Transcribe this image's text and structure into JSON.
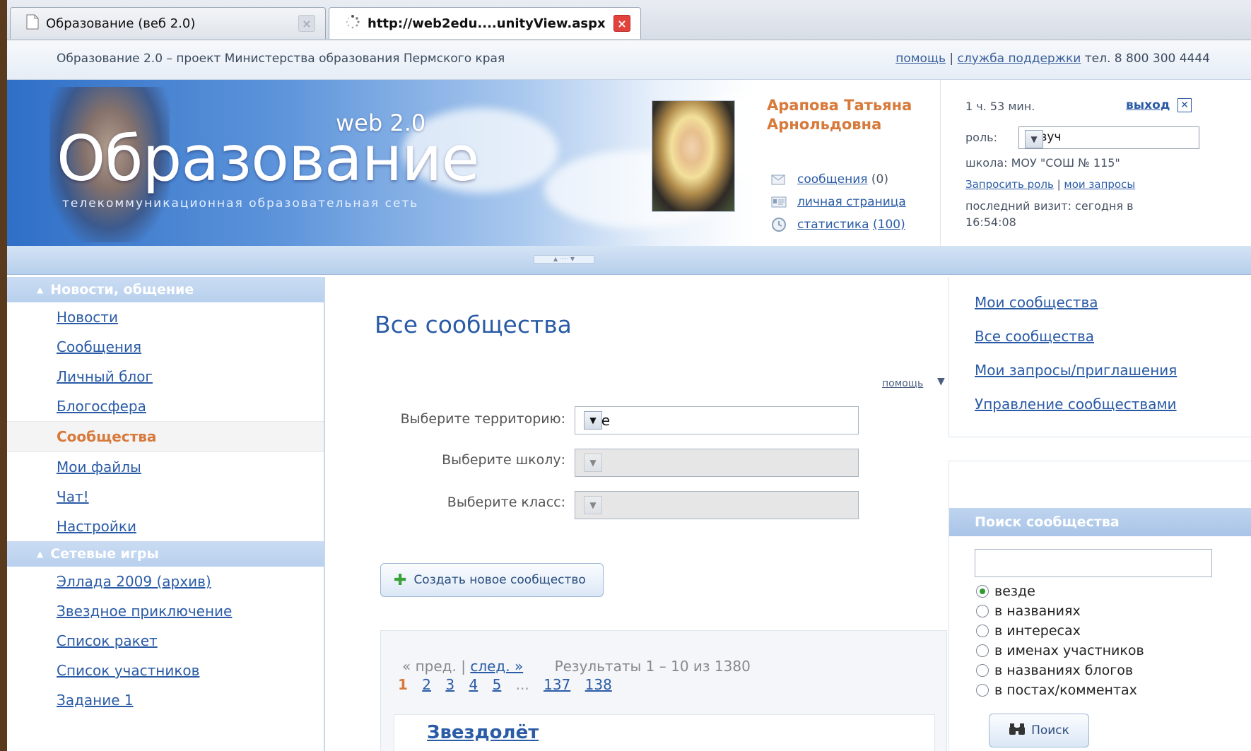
{
  "tabs": [
    {
      "label": "Образование (веб 2.0)",
      "close": "×"
    },
    {
      "label": "http://web2edu....unityView.aspx",
      "close": "×"
    }
  ],
  "topbar": {
    "project": "Образование 2.0 – проект Министерства образования Пермского края",
    "help": "помощь",
    "separator": "|",
    "support": "служба поддержки",
    "phone": "тел. 8 800 300 4444"
  },
  "banner": {
    "web": "web 2.0",
    "logo": "Образование",
    "subtitle": "телекоммуникационная образовательная сеть"
  },
  "user": {
    "name": "Арапова Татьяна Арнольдовна",
    "links": [
      {
        "label": "сообщения",
        "count": "(0)",
        "icon": "envelope-icon"
      },
      {
        "label": "личная страница",
        "count": "",
        "icon": "id-card-icon"
      },
      {
        "label": "статистика",
        "count": "(100)",
        "icon": "clock-icon"
      }
    ],
    "time": "1 ч. 53 мин.",
    "logout": "выход",
    "role_label": "роль:",
    "role_value": "Завуч",
    "school": "школа: МОУ \"СОШ № 115\"",
    "request_role": "Запросить роль",
    "my_requests": "мои запросы",
    "last_visit": "последний визит: сегодня в 16:54:08"
  },
  "leftnav": {
    "section1": "Новости, общение",
    "items1": [
      "Новости",
      "Сообщения",
      "Личный блог",
      "Блогосфера"
    ],
    "active": "Сообщества",
    "items1b": [
      "Мои файлы",
      "Чат!",
      "Настройки"
    ],
    "section2": "Сетевые игры",
    "items2": [
      "Эллада 2009 (архив)",
      "Звездное приключение",
      "Список ракет",
      "Список участников",
      "Задание 1"
    ]
  },
  "main": {
    "title": "Все сообщества",
    "help": "помощь",
    "territory_label": "Выберите территорию:",
    "territory_value": "Все",
    "school_label": "Выберите школу:",
    "class_label": "Выберите класс:",
    "create_button": "Создать новое сообщество",
    "prev": "« пред.",
    "pipe": "|",
    "next": "след. »",
    "results": "Результаты 1 – 10 из 1380",
    "pages": [
      "1",
      "2",
      "3",
      "4",
      "5"
    ],
    "ellipsis": "...",
    "last_pages": [
      "137",
      "138"
    ],
    "first_result": "Звездолёт"
  },
  "right": {
    "links": [
      "Мои сообщества",
      "Все сообщества",
      "Мои запросы/приглашения",
      "Управление сообществами"
    ],
    "search_title": "Поиск сообщества",
    "search_value": "",
    "options": [
      "везде",
      "в названиях",
      "в интересах",
      "в именах участников",
      "в названиях блогов",
      "в постах/комментах"
    ],
    "selected_option": "везде",
    "search_button": "Поиск"
  }
}
